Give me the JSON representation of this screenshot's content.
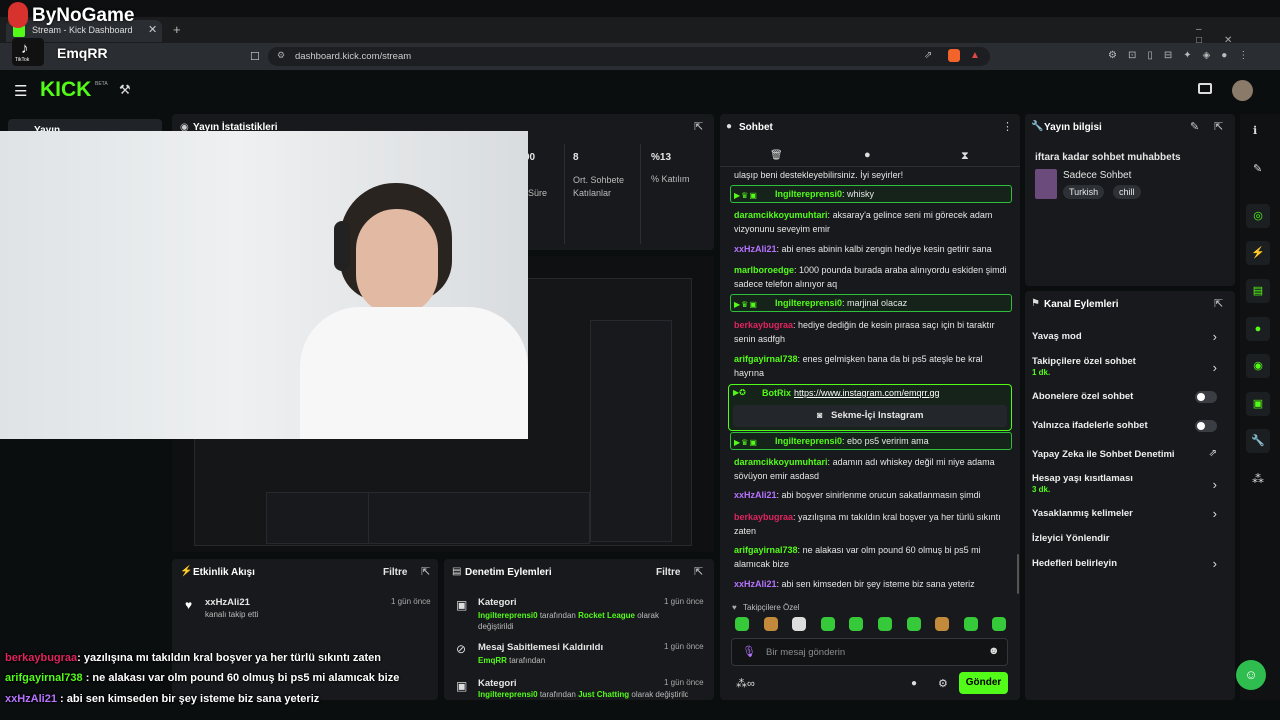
{
  "watermark": {
    "brand": "ByNoGame",
    "tiktok_label": "TikTok",
    "tiktok_user": "EmqRR"
  },
  "browser": {
    "tab_title": "Stream - Kick Dashboard",
    "url": "dashboard.kick.com/stream",
    "new_tab": "+"
  },
  "app": {
    "logo": "KICK",
    "beta": "BETA"
  },
  "sidebar": {
    "active_item": "Yayın"
  },
  "stats": {
    "title": "Yayın İstatistikleri",
    "items": [
      {
        "value": "00",
        "label": "Süre"
      },
      {
        "value": "8",
        "label": "Ort. Sohbete Katılanlar"
      },
      {
        "value": "%13",
        "label": "% Katılım"
      }
    ]
  },
  "activity": {
    "title": "Etkinlik Akışı",
    "filter": "Filtre",
    "events": [
      {
        "user": "xxHzAli21",
        "text": "kanalı takip etti",
        "time": "1 gün önce"
      }
    ]
  },
  "moderation": {
    "title": "Denetim Eylemleri",
    "filter": "Filtre",
    "items": [
      {
        "title": "Kategori",
        "actor": "Ingiltereprensi0",
        "mid": "tarafından",
        "target": "Rocket League",
        "tail": "olarak değiştirildi",
        "time": "1 gün önce"
      },
      {
        "title": "Mesaj Sabitlemesi Kaldırıldı",
        "actor": "EmqRR",
        "mid": "tarafından",
        "target": "",
        "tail": "",
        "time": "1 gün önce"
      },
      {
        "title": "Kategori",
        "actor": "Ingiltereprensi0",
        "mid": "tarafından",
        "target": "Just Chatting",
        "tail": "olarak değiştirildi",
        "time": "1 gün önce"
      }
    ]
  },
  "chat": {
    "title": "Sohbet",
    "top_partial": "ulaşıp beni destekleyebilirsiniz. İyi seyirler!",
    "messages": [
      {
        "user": "Ingiltereprensi0",
        "text": "whisky",
        "mod": true
      },
      {
        "user": "daramcikkoyumuhtari",
        "text": "aksaray'a gelince seni mi görecek adam vizyonunu seveyim emir",
        "mod": false
      },
      {
        "user": "xxHzAli21",
        "text": "abi enes abinin kalbi zengin hediye kesin getirir sana",
        "mod": false
      },
      {
        "user": "marlboroedge",
        "text": "1000 poundа burada araba alınıyordu eskiden şimdi sadece telefon alınıyor aq",
        "mod": false
      },
      {
        "user": "Ingiltereprensi0",
        "text": "marjinal olacaz",
        "mod": true
      },
      {
        "user": "berkaybugraa",
        "text": "hediye dediğin de kesin pırasa saçı için bi taraktır senin asdfgh",
        "mod": false
      },
      {
        "user": "arifgayirnal738",
        "text": "enes gelmişken bana da bi ps5 ateşle be kral hayrına",
        "mod": false
      },
      {
        "user": "Ingiltereprensi0",
        "text": "ebo ps5 veririm ama",
        "mod": true
      },
      {
        "user": "daramcikkoyumuhtari",
        "text": "adamın adı whiskey değil mi niye adama sövüyon emir asdasd",
        "mod": false
      },
      {
        "user": "xxHzAli21",
        "text": "abi boşver sinirlenme orucun sakatlanmasın şimdi",
        "mod": false
      },
      {
        "user": "berkaybugraa",
        "text": "yazılışına mı takıldın kral boşver ya her türlü sıkıntı zaten",
        "mod": false
      },
      {
        "user": "arifgayirnal738",
        "text": "ne alakası var olm pound 60 olmuş bi ps5 mi alamıcak bize",
        "mod": false
      },
      {
        "user": "xxHzAli21",
        "text": "abi sen kimseden bir şey isteme biz sana yeteriz",
        "mod": false
      }
    ],
    "botrix": {
      "user": "BotRix",
      "link": "https://www.instagram.com/emqrr.gg",
      "button": "Sekme-İçi Instagram"
    },
    "followers_only": "Takipçilere Özel",
    "input_placeholder": "Bir mesaj gönderin",
    "send": "Gönder"
  },
  "stream_info": {
    "title": "Yayın bilgisi",
    "stream_title": "iftara kadar sohbet muhabbets",
    "category": "Sadece Sohbet",
    "tags": [
      "Turkish",
      "chill"
    ]
  },
  "channel_actions": {
    "title": "Kanal Eylemleri",
    "rows": [
      {
        "label": "Yavaş mod",
        "sub": "",
        "control": "chevron"
      },
      {
        "label": "Takipçilere özel sohbet",
        "sub": "1 dk.",
        "control": "chevron"
      },
      {
        "label": "Abonelere özel sohbet",
        "sub": "",
        "control": "toggle"
      },
      {
        "label": "Yalnızca ifadelerle sohbet",
        "sub": "",
        "control": "toggle"
      },
      {
        "label": "Yapay Zeka ile Sohbet Denetimi",
        "sub": "",
        "control": "external"
      },
      {
        "label": "Hesap yaşı kısıtlaması",
        "sub": "3 dk.",
        "control": "chevron"
      },
      {
        "label": "Yasaklanmış kelimeler",
        "sub": "",
        "control": "chevron"
      },
      {
        "label": "İzleyici Yönlendir",
        "sub": "",
        "control": "none"
      },
      {
        "label": "Hedefleri belirleyin",
        "sub": "",
        "control": "chevron"
      }
    ]
  },
  "overlay_chat": [
    {
      "user": "berkaybugraa",
      "text": ": yazılışına mı takıldın kral boşver ya her türlü sıkıntı zaten",
      "color": "#e0245e"
    },
    {
      "user": "arifgayirnal738",
      "text": " : ne alakası var olm pound 60 olmuş bi ps5 mi alamıcak bize",
      "color": "#53fc18"
    },
    {
      "user": "xxHzAli21",
      "text": " : abi sen kimseden bir şey isteme biz sana yeteriz",
      "color": "#b673ff"
    }
  ],
  "colors": {
    "accent": "#53fc18",
    "panel": "#17191c",
    "bg": "#0b0e0f",
    "mod_border": "#2fbf3a"
  }
}
